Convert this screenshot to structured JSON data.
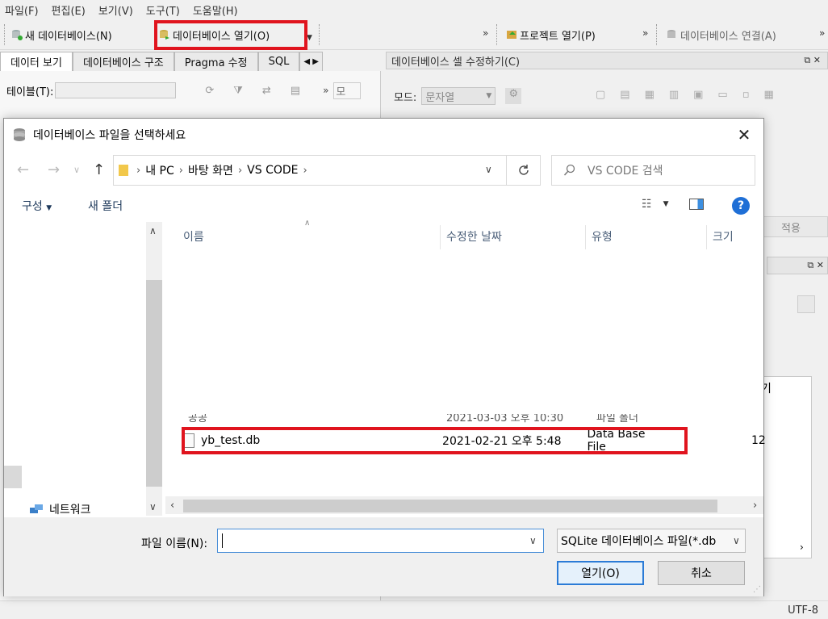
{
  "menu": [
    "파일(F)",
    "편집(E)",
    "보기(V)",
    "도구(T)",
    "도움말(H)"
  ],
  "toolbar": {
    "new_db": "새 데이터베이스(N)",
    "open_db": "데이터베이스 열기(O)",
    "open_project": "프로젝트 열기(P)",
    "connect_db": "데이터베이스 연결(A)",
    "overflow": "»"
  },
  "left_tabs": [
    "데이터 보기",
    "데이터베이스 구조",
    "Pragma 수정",
    "SQL"
  ],
  "left": {
    "table_label": "테이블(T):",
    "more_label": "모"
  },
  "right": {
    "header": "데이터베이스 셀 수정하기(C)",
    "mode_label": "모드:",
    "mode_value": "문자열",
    "apply": "적용",
    "partial_text": "기"
  },
  "status": {
    "encoding": "UTF-8"
  },
  "dialog": {
    "title": "데이터베이스 파일을 선택하세요",
    "breadcrumbs": [
      "내 PC",
      "바탕 화면",
      "VS CODE"
    ],
    "search_placeholder": "VS CODE 검색",
    "organize": "구성",
    "new_folder": "새 폴더",
    "help": "?",
    "nav_network": "네트워크",
    "columns": {
      "name": "이름",
      "modified": "수정한 날짜",
      "type": "유형",
      "size": "크기"
    },
    "partial_row": {
      "name": "공공",
      "modified": "2021-03-03 오후 10:30",
      "type": "파일 폴더"
    },
    "file": {
      "name": "yb_test.db",
      "modified": "2021-02-21 오후 5:48",
      "type": "Data Base File",
      "size": "12"
    },
    "filename_label": "파일 이름(N):",
    "filename_value": "",
    "filetype": "SQLite 데이터베이스 파일(*.db",
    "open_button": "열기(O)",
    "cancel_button": "취소"
  },
  "colors": {
    "highlight": "#e0141e",
    "accent": "#2b7bd6"
  }
}
